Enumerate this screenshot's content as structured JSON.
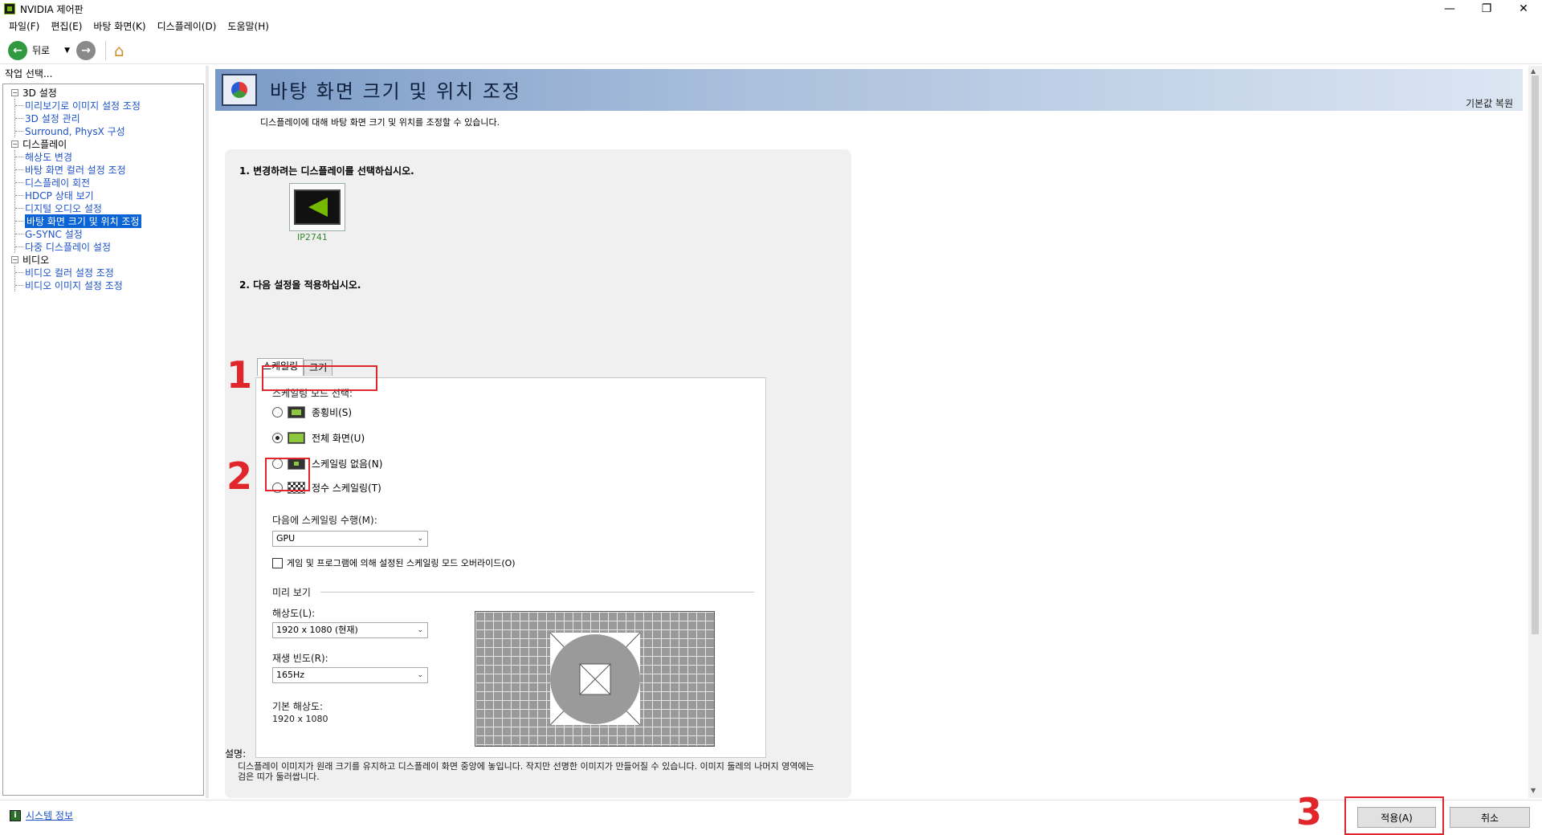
{
  "window": {
    "title": "NVIDIA 제어판",
    "controls": [
      "—",
      "❐",
      "✕"
    ]
  },
  "menu": [
    "파일(F)",
    "편집(E)",
    "바탕 화면(K)",
    "디스플레이(D)",
    "도움말(H)"
  ],
  "toolbar": {
    "back_label": "뒤로"
  },
  "left": {
    "header": "작업 선택...",
    "groups": [
      {
        "label": "3D 설정",
        "items": [
          "미리보기로 이미지 설정 조정",
          "3D 설정 관리",
          "Surround, PhysX 구성"
        ]
      },
      {
        "label": "디스플레이",
        "items": [
          "해상도 변경",
          "바탕 화면 컬러 설정 조정",
          "디스플레이 회전",
          "HDCP 상태 보기",
          "디지털 오디오 설정",
          "바탕 화면 크기 및 위치 조정",
          "G-SYNC 설정",
          "다중 디스플레이 설정"
        ]
      },
      {
        "label": "비디오",
        "items": [
          "비디오 컬러 설정 조정",
          "비디오 이미지 설정 조정"
        ]
      }
    ],
    "selected_item": "바탕 화면 크기 및 위치 조정"
  },
  "main": {
    "title": "바탕 화면 크기 및 위치 조정",
    "restore_defaults": "기본값 복원",
    "description": "디스플레이에 대해 바탕 화면 크기 및 위치를 조정할 수 있습니다.",
    "step1": "1. 변경하려는 디스플레이를 선택하십시오.",
    "display_name": "IP2741",
    "step2": "2. 다음 설정을 적용하십시오.",
    "tabs": [
      "스케일링",
      "크기"
    ],
    "active_tab": "스케일링",
    "scaling_mode_label": "스케일링 모드 선택:",
    "modes": [
      {
        "label": "종횡비(S)",
        "icon": "aspect-ratio-icon",
        "checked": false
      },
      {
        "label": "전체 화면(U)",
        "icon": "full-screen-icon",
        "checked": true
      },
      {
        "label": "스케일링 없음(N)",
        "icon": "no-scaling-icon",
        "checked": false
      },
      {
        "label": "정수 스케일링(T)",
        "icon": "integer-scaling-icon",
        "checked": false
      }
    ],
    "perform_on_label": "다음에 스케일링 수행(M):",
    "perform_on_value": "GPU",
    "override_label": "게임 및 프로그램에 의해 설정된 스케일링 모드 오버라이드(O)",
    "override_checked": false,
    "preview_label": "미리 보기",
    "resolution_label": "해상도(L):",
    "resolution_value": "1920 x 1080 (현재)",
    "refresh_label": "재생 빈도(R):",
    "refresh_value": "165Hz",
    "native_label": "기본 해상도:",
    "native_value": "1920 x 1080",
    "explain_label": "설명:",
    "explain_text": "디스플레이 이미지가 원래 크기를 유지하고 디스플레이 화면 중앙에 놓입니다. 작지만 선명한 이미지가 만들어질 수 있습니다. 이미지 둘레의 나머지 영역에는 검은 띠가 둘러쌉니다."
  },
  "footer": {
    "system_info": "시스템 정보",
    "apply": "적용(A)",
    "cancel": "취소"
  },
  "annotations": [
    "1",
    "2",
    "3"
  ],
  "colors": {
    "annotation": "#e0262a",
    "selection": "#0a64d6",
    "link": "#1d52c7",
    "nvidia_green": "#76b900"
  }
}
